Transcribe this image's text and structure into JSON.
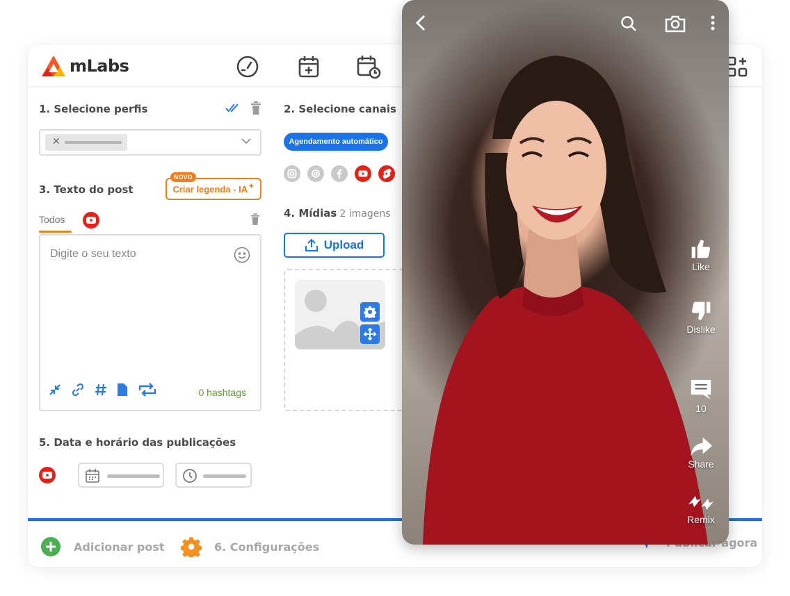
{
  "app": {
    "name": "mLabs"
  },
  "sections": {
    "profiles": {
      "title": "1. Selecione perfis"
    },
    "channels": {
      "title": "2. Selecione canais",
      "auto_label": "Agendamento automático"
    },
    "post_text": {
      "title": "3. Texto do post",
      "ai_badge": "NOVO",
      "ai_button": "Criar legenda - IA",
      "tab_all": "Todos",
      "placeholder": "Digite o seu texto",
      "hashtags": "0 hashtags"
    },
    "media": {
      "title": "4. Mídias",
      "subtitle": "2 imagens",
      "upload_label": "Upload"
    },
    "schedule": {
      "title": "5. Data e horário das publicações"
    }
  },
  "footer": {
    "add_post": "Adicionar post",
    "settings": "6. Configurações",
    "publish": "Publicar agora"
  },
  "video": {
    "like": "Like",
    "dislike": "Dislike",
    "comments": "10",
    "share": "Share",
    "remix": "Remix"
  },
  "colors": {
    "accent": "#1a73e8",
    "orange": "#f07d1e",
    "youtube": "#e62117",
    "green": "#5aa02c"
  }
}
